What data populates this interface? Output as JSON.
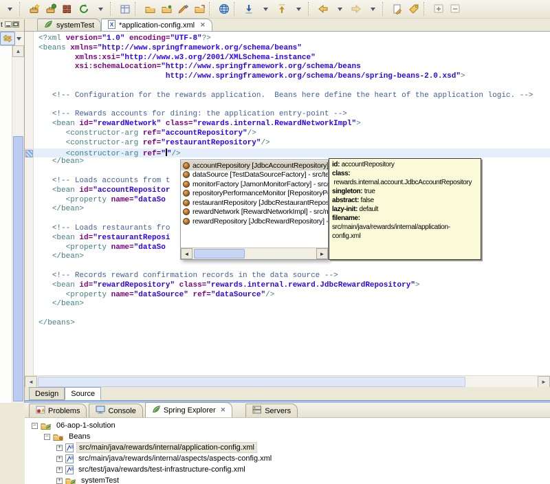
{
  "colors": {
    "desktop_chrome": "#ECE9D8",
    "editor_background": "#FFFFFF",
    "current_line_highlight": "#E4EFFB",
    "tooltip_background": "#FAFAD8",
    "syntax_tag": "#3F7F7F",
    "syntax_attribute": "#7F007F",
    "syntax_value": "#2A00FF",
    "syntax_comment": "#3F5F9F",
    "selection_inactive": "#D9D5C7"
  },
  "toolbar": {
    "items": [
      "overflow-caret",
      "sep",
      "new-wizard",
      "new-class-wizard",
      "new-grid",
      "refresh-green",
      "caret",
      "sep",
      "show-table",
      "sep",
      "open-folder",
      "open-folder2",
      "paintbrush",
      "open-folder3",
      "sep",
      "web-globe",
      "sep",
      "down-annot",
      "caret",
      "up-annot",
      "caret",
      "sep",
      "back-arrow",
      "caret",
      "forward-arrow",
      "caret",
      "sep",
      "last-edit",
      "goto-tag",
      "sep",
      "expand-all",
      "collapse-all"
    ]
  },
  "left_strip": {
    "tab_label_fragment": "t",
    "buttons": [
      "minimize",
      "maximize"
    ],
    "tool": "link-with-editor"
  },
  "editor_tabs": [
    {
      "label": "systemTest",
      "icon": "leaf",
      "active": false,
      "close": false
    },
    {
      "label": "*application-config.xml",
      "icon": "xml-page",
      "active": true,
      "close": true
    }
  ],
  "code": {
    "lines": [
      {
        "s": [
          [
            "g",
            "<?xml "
          ],
          [
            "a",
            "version="
          ],
          [
            "v",
            "\"1.0\""
          ],
          [
            "a",
            " encoding="
          ],
          [
            "v",
            "\"UTF-8\""
          ],
          [
            "g",
            "?>"
          ]
        ]
      },
      {
        "s": [
          [
            "g",
            "<beans "
          ],
          [
            "a",
            "xmlns="
          ],
          [
            "v",
            "\"http://www.springframework.org/schema/beans\""
          ]
        ]
      },
      {
        "s": [
          [
            "w",
            "        "
          ],
          [
            "a",
            "xmlns:xsi="
          ],
          [
            "v",
            "\"http://www.w3.org/2001/XMLSchema-instance\""
          ]
        ]
      },
      {
        "s": [
          [
            "w",
            "        "
          ],
          [
            "a",
            "xsi:schemaLocation="
          ],
          [
            "v",
            "\"http://www.springframework.org/schema/beans"
          ]
        ]
      },
      {
        "s": [
          [
            "w",
            "                            "
          ],
          [
            "v",
            "http://www.springframework.org/schema/beans/spring-beans-2.0.xsd\""
          ],
          [
            "g",
            ">"
          ]
        ]
      },
      {
        "s": []
      },
      {
        "s": [
          [
            "w",
            "   "
          ],
          [
            "c",
            "<!-- Configuration for the rewards application.  Beans here define the heart of the application logic. -->"
          ]
        ]
      },
      {
        "s": []
      },
      {
        "s": [
          [
            "w",
            "   "
          ],
          [
            "c",
            "<!-- Rewards accounts for dining: the application entry-point -->"
          ]
        ]
      },
      {
        "s": [
          [
            "w",
            "   "
          ],
          [
            "g",
            "<bean "
          ],
          [
            "a",
            "id="
          ],
          [
            "v",
            "\"rewardNetwork\""
          ],
          [
            "w",
            " "
          ],
          [
            "a",
            "class="
          ],
          [
            "v",
            "\"rewards.internal.RewardNetworkImpl\""
          ],
          [
            "g",
            ">"
          ]
        ]
      },
      {
        "s": [
          [
            "w",
            "      "
          ],
          [
            "g",
            "<constructor-arg "
          ],
          [
            "a",
            "ref="
          ],
          [
            "v",
            "\"accountRepository\""
          ],
          [
            "g",
            "/>"
          ]
        ]
      },
      {
        "s": [
          [
            "w",
            "      "
          ],
          [
            "g",
            "<constructor-arg "
          ],
          [
            "a",
            "ref="
          ],
          [
            "v",
            "\"restaurantRepository\""
          ],
          [
            "g",
            "/>"
          ]
        ]
      },
      {
        "cur": true,
        "s": [
          [
            "w",
            "      "
          ],
          [
            "g",
            "<constructor-arg "
          ],
          [
            "a",
            "ref="
          ],
          [
            "v",
            "\""
          ],
          [
            "k",
            ""
          ],
          [
            "v",
            "\""
          ],
          [
            "g",
            "/>"
          ]
        ]
      },
      {
        "s": [
          [
            "w",
            "   "
          ],
          [
            "g",
            "</bean>"
          ]
        ]
      },
      {
        "s": []
      },
      {
        "s": [
          [
            "w",
            "   "
          ],
          [
            "c",
            "<!-- Loads accounts from t"
          ]
        ]
      },
      {
        "s": [
          [
            "w",
            "   "
          ],
          [
            "g",
            "<bean "
          ],
          [
            "a",
            "id="
          ],
          [
            "v",
            "\"accountRepositor"
          ]
        ]
      },
      {
        "s": [
          [
            "w",
            "      "
          ],
          [
            "g",
            "<property "
          ],
          [
            "a",
            "name="
          ],
          [
            "v",
            "\"dataSo"
          ]
        ]
      },
      {
        "s": [
          [
            "w",
            "   "
          ],
          [
            "g",
            "</bean>"
          ]
        ]
      },
      {
        "s": []
      },
      {
        "s": [
          [
            "w",
            "   "
          ],
          [
            "c",
            "<!-- Loads restaurants fro"
          ]
        ]
      },
      {
        "s": [
          [
            "w",
            "   "
          ],
          [
            "g",
            "<bean "
          ],
          [
            "a",
            "id="
          ],
          [
            "v",
            "\"restaurantReposi"
          ]
        ]
      },
      {
        "s": [
          [
            "w",
            "      "
          ],
          [
            "g",
            "<property "
          ],
          [
            "a",
            "name="
          ],
          [
            "v",
            "\"dataSo"
          ]
        ]
      },
      {
        "s": [
          [
            "w",
            "   "
          ],
          [
            "g",
            "</bean>"
          ]
        ]
      },
      {
        "s": []
      },
      {
        "s": [
          [
            "w",
            "   "
          ],
          [
            "c",
            "<!-- Records reward confirmation records in the data source -->"
          ]
        ]
      },
      {
        "s": [
          [
            "w",
            "   "
          ],
          [
            "g",
            "<bean "
          ],
          [
            "a",
            "id="
          ],
          [
            "v",
            "\"rewardRepository\""
          ],
          [
            "w",
            " "
          ],
          [
            "a",
            "class="
          ],
          [
            "v",
            "\"rewards.internal.reward.JdbcRewardRepository\""
          ],
          [
            "g",
            ">"
          ]
        ]
      },
      {
        "s": [
          [
            "w",
            "      "
          ],
          [
            "g",
            "<property "
          ],
          [
            "a",
            "name="
          ],
          [
            "v",
            "\"dataSource\""
          ],
          [
            "w",
            " "
          ],
          [
            "a",
            "ref="
          ],
          [
            "v",
            "\"dataSource\""
          ],
          [
            "g",
            "/>"
          ]
        ]
      },
      {
        "s": [
          [
            "w",
            "   "
          ],
          [
            "g",
            "</bean>"
          ]
        ]
      },
      {
        "s": []
      },
      {
        "s": [
          [
            "g",
            "</beans>"
          ]
        ]
      }
    ]
  },
  "completion": {
    "items": [
      {
        "text": "accountRepository [JdbcAccountRepository] - src",
        "selected": true
      },
      {
        "text": "dataSource [TestDataSourceFactory] - src/test/ja",
        "selected": false
      },
      {
        "text": "monitorFactory [JamonMonitorFactory] - src/main",
        "selected": false
      },
      {
        "text": "repositoryPerformanceMonitor [RepositoryPerform",
        "selected": false
      },
      {
        "text": "restaurantRepository [JdbcRestaurantRepository",
        "selected": false
      },
      {
        "text": "rewardNetwork [RewardNetworkImpl] - src/main/j",
        "selected": false
      },
      {
        "text": "rewardRepository [JdbcRewardRepository] - src/r",
        "selected": false
      }
    ]
  },
  "bean_tooltip": {
    "fields": [
      {
        "label": "id",
        "value": "accountRepository",
        "value_on_next_line": false
      },
      {
        "label": "class",
        "value": "rewards.internal.account.JdbcAccountRepository",
        "value_on_next_line": true
      },
      {
        "label": "singleton",
        "value": "true",
        "value_on_next_line": false
      },
      {
        "label": "abstract",
        "value": "false",
        "value_on_next_line": false
      },
      {
        "label": "lazy-init",
        "value": "default",
        "value_on_next_line": false
      },
      {
        "label": "filename",
        "value": "src/main/java/rewards/internal/application-config.xml",
        "value_on_next_line": false
      }
    ]
  },
  "editor_footer": {
    "design": "Design",
    "source": "Source",
    "active": "Source"
  },
  "panel_tabs": [
    {
      "label": "Problems",
      "icon": "problems",
      "active": false,
      "close": false,
      "gap": false
    },
    {
      "label": "Console",
      "icon": "console",
      "active": false,
      "close": false,
      "gap": false
    },
    {
      "label": "Spring Explorer",
      "icon": "leaf",
      "active": true,
      "close": true,
      "gap": false
    },
    {
      "label": "Servers",
      "icon": "servers",
      "active": false,
      "close": false,
      "gap": true
    }
  ],
  "explorer": {
    "tree": [
      {
        "level": 0,
        "exp": "minus",
        "icon": "spring-project",
        "label": "06-aop-1-solution",
        "selected": false
      },
      {
        "level": 1,
        "exp": "minus",
        "icon": "beans-folder",
        "label": "Beans",
        "selected": false
      },
      {
        "level": 2,
        "exp": "plus",
        "icon": "spring-config",
        "label": "src/main/java/rewards/internal/application-config.xml",
        "selected": true
      },
      {
        "level": 2,
        "exp": "plus",
        "icon": "spring-config",
        "label": "src/main/java/rewards/internal/aspects/aspects-config.xml",
        "selected": false
      },
      {
        "level": 2,
        "exp": "plus",
        "icon": "spring-config",
        "label": "src/test/java/rewards/test-infrastructure-config.xml",
        "selected": false
      },
      {
        "level": 2,
        "exp": "plus",
        "icon": "config-set",
        "label": "systemTest",
        "selected": false
      }
    ]
  },
  "glyphs": {
    "close": "✕",
    "minus": "−",
    "plus": "+",
    "scroll_up": "▲",
    "scroll_left": "◄",
    "scroll_right": "►"
  }
}
